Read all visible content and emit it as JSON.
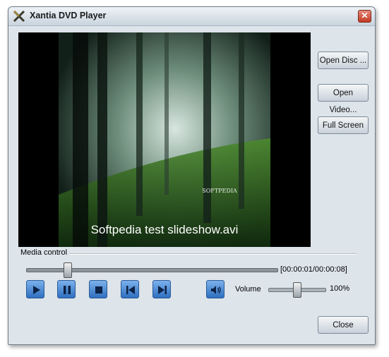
{
  "window": {
    "title": "Xantia DVD Player"
  },
  "video": {
    "subtitle": "Softpedia test slideshow.avi",
    "watermark": "SOFTPEDIA"
  },
  "side_buttons": {
    "open_disc": "Open Disc ...",
    "open_video": "Open Video...",
    "full_screen": "Full Screen"
  },
  "media_control": {
    "group_label": "Media control",
    "time_display": "[00:00:01/00:00:08]",
    "seek_fraction": 0.125
  },
  "volume": {
    "label": "Volume",
    "value": "100%"
  },
  "footer": {
    "close": "Close"
  },
  "colors": {
    "titlebar": "#c9d4de",
    "window_bg": "#dde4ea",
    "control_blue": "#2f6fc0"
  }
}
